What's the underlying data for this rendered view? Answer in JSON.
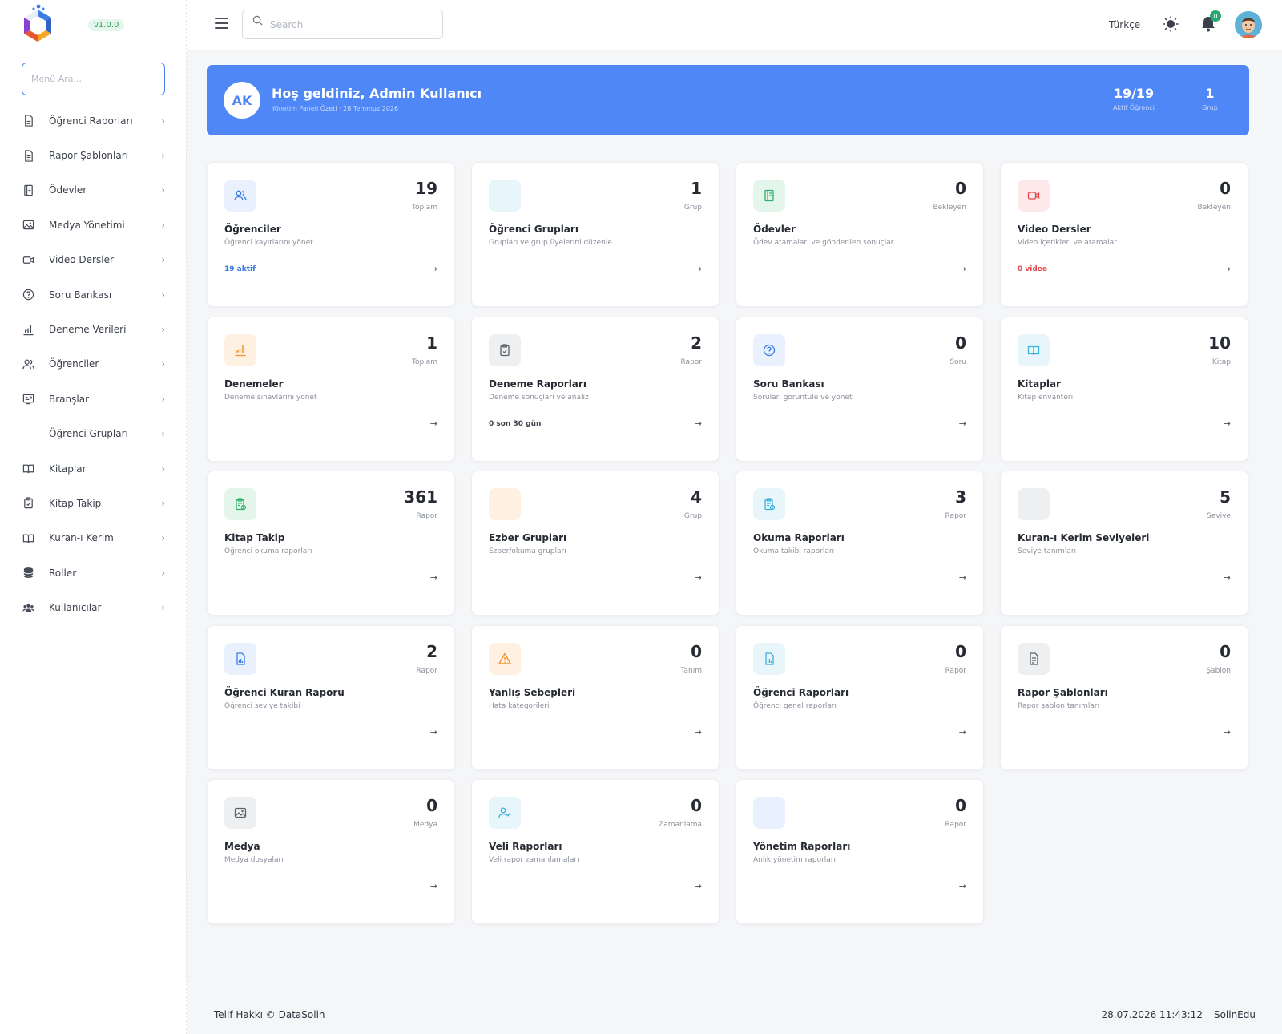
{
  "app": {
    "version": "v1.0.0"
  },
  "sidebar": {
    "search_placeholder": "Menü Ara...",
    "items": [
      {
        "label": "Öğrenci Raporları",
        "icon": "document-icon"
      },
      {
        "label": "Rapor Şablonları",
        "icon": "file-text-icon"
      },
      {
        "label": "Ödevler",
        "icon": "notebook-icon"
      },
      {
        "label": "Medya Yönetimi",
        "icon": "image-icon"
      },
      {
        "label": "Video Dersler",
        "icon": "video-icon"
      },
      {
        "label": "Soru Bankası",
        "icon": "question-icon"
      },
      {
        "label": "Deneme Verileri",
        "icon": "chart-icon"
      },
      {
        "label": "Öğrenciler",
        "icon": "users-icon"
      },
      {
        "label": "Branşlar",
        "icon": "branch-icon"
      },
      {
        "label": "Öğrenci Grupları",
        "icon": ""
      },
      {
        "label": "Kitaplar",
        "icon": "book-icon"
      },
      {
        "label": "Kitap Takip",
        "icon": "clipboard-icon"
      },
      {
        "label": "Kuran-ı Kerim",
        "icon": "book-open-icon"
      },
      {
        "label": "Roller",
        "icon": "database-icon"
      },
      {
        "label": "Kullanıcılar",
        "icon": "users-group-icon"
      }
    ]
  },
  "topbar": {
    "search_placeholder": "Search",
    "language": "Türkçe",
    "notification_count": "0"
  },
  "banner": {
    "initials": "AK",
    "welcome": "Hoş geldiniz, Admin Kullanıcı",
    "subline": "Yönetim Paneli Özeti · 28 Temmuz 2026",
    "stats": [
      {
        "value": "19/19",
        "label": "Aktif Öğrenci"
      },
      {
        "value": "1",
        "label": "Grup"
      }
    ]
  },
  "cards": [
    {
      "title": "Öğrenciler",
      "desc": "Öğrenci kayıtlarını yönet",
      "value": "19",
      "unit": "Toplam",
      "note": "19 aktif",
      "note_color": "#3b7ce8",
      "icon": "users-icon",
      "icon_bg": "#e9f0fe",
      "icon_color": "#3b7ce8"
    },
    {
      "title": "Öğrenci Grupları",
      "desc": "Grupları ve grup üyelerini düzenle",
      "value": "1",
      "unit": "Grup",
      "note": "",
      "note_color": "#3b7ce8",
      "icon": "",
      "icon_bg": "#e8f6fc",
      "icon_color": "#3bb1dc"
    },
    {
      "title": "Ödevler",
      "desc": "Ödev atamaları ve gönderilen sonuçlar",
      "value": "0",
      "unit": "Bekleyen",
      "note": "",
      "note_color": "#3b7ce8",
      "icon": "notebook-icon",
      "icon_bg": "#e4f6ec",
      "icon_color": "#2fb069"
    },
    {
      "title": "Video Dersler",
      "desc": "Video içerikleri ve atamalar",
      "value": "0",
      "unit": "Bekleyen",
      "note": "0 video",
      "note_color": "#e5484d",
      "icon": "video-icon",
      "icon_bg": "#fde9ea",
      "icon_color": "#e5484d"
    },
    {
      "title": "Denemeler",
      "desc": "Deneme sınavlarını yönet",
      "value": "1",
      "unit": "Toplam",
      "note": "",
      "note_color": "#3b7ce8",
      "icon": "chart-icon",
      "icon_bg": "#fff1e2",
      "icon_color": "#f0962e"
    },
    {
      "title": "Deneme Raporları",
      "desc": "Deneme sonuçları ve analiz",
      "value": "2",
      "unit": "Rapor",
      "note": "0 son 30 gün",
      "note_color": "#3d424d",
      "icon": "clipboard-icon",
      "icon_bg": "#eeeff1",
      "icon_color": "#5b606b"
    },
    {
      "title": "Soru Bankası",
      "desc": "Soruları görüntüle ve yönet",
      "value": "0",
      "unit": "Soru",
      "note": "",
      "note_color": "#3b7ce8",
      "icon": "question-icon",
      "icon_bg": "#e9f0fe",
      "icon_color": "#3b7ce8"
    },
    {
      "title": "Kitaplar",
      "desc": "Kitap envanteri",
      "value": "10",
      "unit": "Kitap",
      "note": "",
      "note_color": "#3b7ce8",
      "icon": "book-open-icon",
      "icon_bg": "#e8f6fc",
      "icon_color": "#3bb1dc"
    },
    {
      "title": "Kitap Takip",
      "desc": "Öğrenci okuma raporları",
      "value": "361",
      "unit": "Rapor",
      "note": "",
      "note_color": "#3b7ce8",
      "icon": "clipboard-check-icon",
      "icon_bg": "#e4f6ec",
      "icon_color": "#2fb069"
    },
    {
      "title": "Ezber Grupları",
      "desc": "Ezber/okuma grupları",
      "value": "4",
      "unit": "Grup",
      "note": "",
      "note_color": "#3b7ce8",
      "icon": "",
      "icon_bg": "#fff1e2",
      "icon_color": "#f0962e"
    },
    {
      "title": "Okuma Raporları",
      "desc": "Okuma takibi raporları",
      "value": "3",
      "unit": "Rapor",
      "note": "",
      "note_color": "#3b7ce8",
      "icon": "clipboard-check-icon",
      "icon_bg": "#e8f6fc",
      "icon_color": "#3bb1dc"
    },
    {
      "title": "Kuran-ı Kerim Seviyeleri",
      "desc": "Seviye tanımları",
      "value": "5",
      "unit": "Seviye",
      "note": "",
      "note_color": "#3b7ce8",
      "icon": "",
      "icon_bg": "#eeeff1",
      "icon_color": "#5b606b"
    },
    {
      "title": "Öğrenci Kuran Raporu",
      "desc": "Öğrenci seviye takibi",
      "value": "2",
      "unit": "Rapor",
      "note": "",
      "note_color": "#3b7ce8",
      "icon": "file-chart-icon",
      "icon_bg": "#e9f0fe",
      "icon_color": "#3b7ce8"
    },
    {
      "title": "Yanlış Sebepleri",
      "desc": "Hata kategorileri",
      "value": "0",
      "unit": "Tanım",
      "note": "",
      "note_color": "#3b7ce8",
      "icon": "warning-icon",
      "icon_bg": "#fff1e2",
      "icon_color": "#f0962e"
    },
    {
      "title": "Öğrenci Raporları",
      "desc": "Öğrenci genel raporları",
      "value": "0",
      "unit": "Rapor",
      "note": "",
      "note_color": "#3b7ce8",
      "icon": "file-chart-icon",
      "icon_bg": "#e8f6fc",
      "icon_color": "#3bb1dc"
    },
    {
      "title": "Rapor Şablonları",
      "desc": "Rapor şablon tanımları",
      "value": "0",
      "unit": "Şablon",
      "note": "",
      "note_color": "#3b7ce8",
      "icon": "file-text-icon",
      "icon_bg": "#eeeff1",
      "icon_color": "#5b606b"
    },
    {
      "title": "Medya",
      "desc": "Medya dosyaları",
      "value": "0",
      "unit": "Medya",
      "note": "",
      "note_color": "#3b7ce8",
      "icon": "image-icon",
      "icon_bg": "#eeeff1",
      "icon_color": "#5b606b"
    },
    {
      "title": "Veli Raporları",
      "desc": "Veli rapor zamanlamaları",
      "value": "0",
      "unit": "Zamanlama",
      "note": "",
      "note_color": "#3b7ce8",
      "icon": "user-check-icon",
      "icon_bg": "#e8f6fc",
      "icon_color": "#3bb1dc"
    },
    {
      "title": "Yönetim Raporları",
      "desc": "Anlık yönetim raporları",
      "value": "0",
      "unit": "Rapor",
      "note": "",
      "note_color": "#3b7ce8",
      "icon": "",
      "icon_bg": "#e9f0fe",
      "icon_color": "#3b7ce8"
    }
  ],
  "footer": {
    "copyright": "Telif Hakkı © DataSolin",
    "datetime": "28.07.2026 11:43:12",
    "brand": "SolinEdu"
  }
}
